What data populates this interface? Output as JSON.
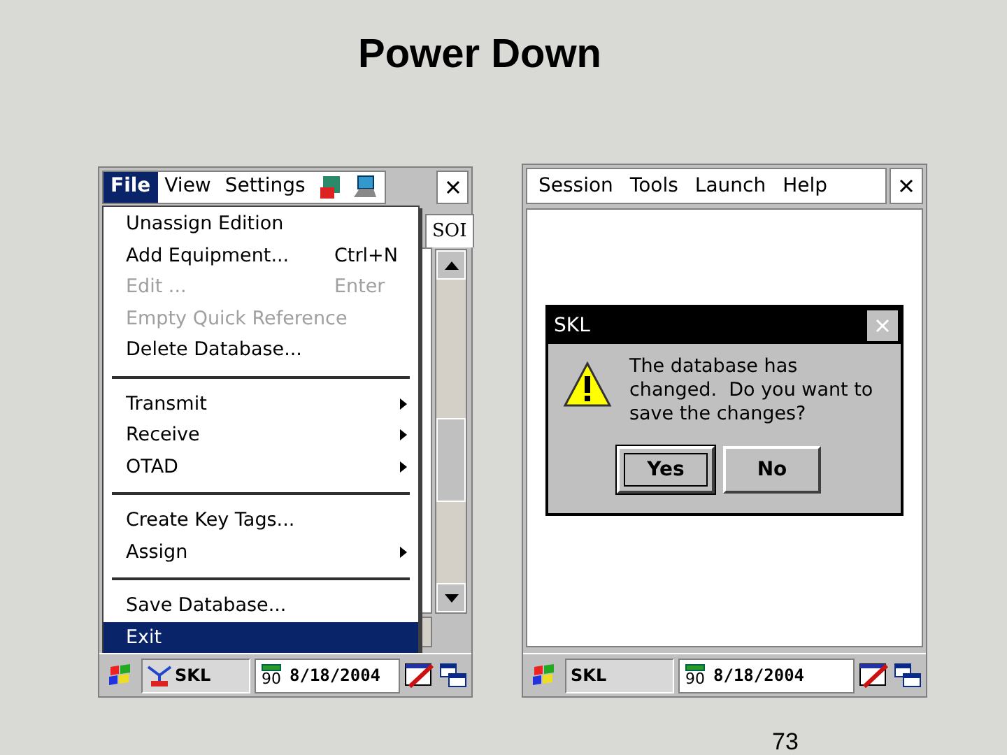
{
  "slide": {
    "title": "Power Down",
    "page_number": "73"
  },
  "left_screen": {
    "menu_bar": [
      {
        "label": "File",
        "selected": true
      },
      {
        "label": "View",
        "selected": false
      },
      {
        "label": "Settings",
        "selected": false
      }
    ],
    "tab": "SOI",
    "menu": [
      {
        "kind": "item",
        "label": "Unassign Edition",
        "disabled": false,
        "selected": false
      },
      {
        "kind": "item",
        "label": "Add Equipment...",
        "shortcut": "Ctrl+N",
        "disabled": false,
        "selected": false
      },
      {
        "kind": "item",
        "label": "Edit ...",
        "shortcut": "Enter",
        "disabled": true,
        "selected": false
      },
      {
        "kind": "item",
        "label": "Empty Quick Reference",
        "disabled": true,
        "selected": false
      },
      {
        "kind": "item",
        "label": "Delete Database...",
        "disabled": false,
        "selected": false
      },
      {
        "kind": "separator"
      },
      {
        "kind": "submenu",
        "label": "Transmit",
        "disabled": false,
        "selected": false
      },
      {
        "kind": "submenu",
        "label": "Receive",
        "disabled": false,
        "selected": false
      },
      {
        "kind": "submenu",
        "label": "OTAD",
        "disabled": false,
        "selected": false
      },
      {
        "kind": "separator"
      },
      {
        "kind": "item",
        "label": "Create Key Tags...",
        "disabled": false,
        "selected": false
      },
      {
        "kind": "submenu",
        "label": "Assign",
        "disabled": false,
        "selected": false
      },
      {
        "kind": "separator"
      },
      {
        "kind": "item",
        "label": "Save Database...",
        "disabled": false,
        "selected": false
      },
      {
        "kind": "item",
        "label": "Exit",
        "disabled": false,
        "selected": true
      }
    ],
    "taskbar": {
      "task": "SKL",
      "battery": "90",
      "date": "8/18/2004"
    }
  },
  "right_screen": {
    "menu_bar": [
      "Session",
      "Tools",
      "Launch",
      "Help"
    ],
    "dialog": {
      "title": "SKL",
      "message": "The database has changed.  Do you want to save the changes?",
      "buttons": [
        {
          "label": "Yes",
          "focused": true
        },
        {
          "label": "No",
          "focused": false
        }
      ]
    },
    "taskbar": {
      "task": "SKL",
      "battery": "90",
      "date": "8/18/2004"
    }
  }
}
